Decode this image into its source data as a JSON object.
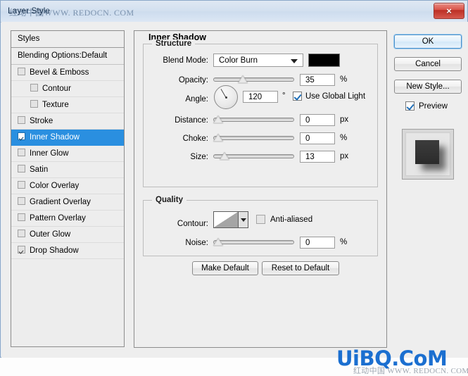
{
  "window": {
    "title": "Layer Style",
    "title_watermark": "红动中国WWW. REDOCN. COM",
    "close_icon": "×"
  },
  "styles_panel": {
    "header": "Styles",
    "blending_options": "Blending Options:Default",
    "items": [
      {
        "label": "Bevel & Emboss",
        "checked": false,
        "indent": false,
        "selected": false
      },
      {
        "label": "Contour",
        "checked": false,
        "indent": true,
        "selected": false
      },
      {
        "label": "Texture",
        "checked": false,
        "indent": true,
        "selected": false
      },
      {
        "label": "Stroke",
        "checked": false,
        "indent": false,
        "selected": false
      },
      {
        "label": "Inner Shadow",
        "checked": true,
        "indent": false,
        "selected": true
      },
      {
        "label": "Inner Glow",
        "checked": false,
        "indent": false,
        "selected": false
      },
      {
        "label": "Satin",
        "checked": false,
        "indent": false,
        "selected": false
      },
      {
        "label": "Color Overlay",
        "checked": false,
        "indent": false,
        "selected": false
      },
      {
        "label": "Gradient Overlay",
        "checked": false,
        "indent": false,
        "selected": false
      },
      {
        "label": "Pattern Overlay",
        "checked": false,
        "indent": false,
        "selected": false
      },
      {
        "label": "Outer Glow",
        "checked": false,
        "indent": false,
        "selected": false
      },
      {
        "label": "Drop Shadow",
        "checked": true,
        "indent": false,
        "selected": false
      }
    ]
  },
  "panel": {
    "title": "Inner Shadow",
    "structure": {
      "title": "Structure",
      "blend_mode_label": "Blend Mode:",
      "blend_mode_value": "Color Burn",
      "shadow_color": "#000000",
      "opacity_label": "Opacity:",
      "opacity_value": "35",
      "opacity_unit": "%",
      "opacity_percent": 35,
      "angle_label": "Angle:",
      "angle_value": "120",
      "angle_unit": "°",
      "angle_degrees": 120,
      "global_light_label": "Use Global Light",
      "global_light_checked": true,
      "distance_label": "Distance:",
      "distance_value": "0",
      "distance_unit": "px",
      "distance_percent": 0,
      "choke_label": "Choke:",
      "choke_value": "0",
      "choke_unit": "%",
      "choke_percent": 0,
      "size_label": "Size:",
      "size_value": "13",
      "size_unit": "px",
      "size_percent": 9
    },
    "quality": {
      "title": "Quality",
      "contour_label": "Contour:",
      "anti_aliased_label": "Anti-aliased",
      "anti_aliased_checked": false,
      "noise_label": "Noise:",
      "noise_value": "0",
      "noise_unit": "%",
      "noise_percent": 0
    },
    "make_default": "Make Default",
    "reset_to_default": "Reset to Default"
  },
  "actions": {
    "ok": "OK",
    "cancel": "Cancel",
    "new_style": "New Style...",
    "preview_label": "Preview",
    "preview_checked": true
  },
  "watermark": {
    "bottom": "UiBQ.CoM",
    "bottom_sub": "红动中国 WWW. REDOCN. COM"
  }
}
